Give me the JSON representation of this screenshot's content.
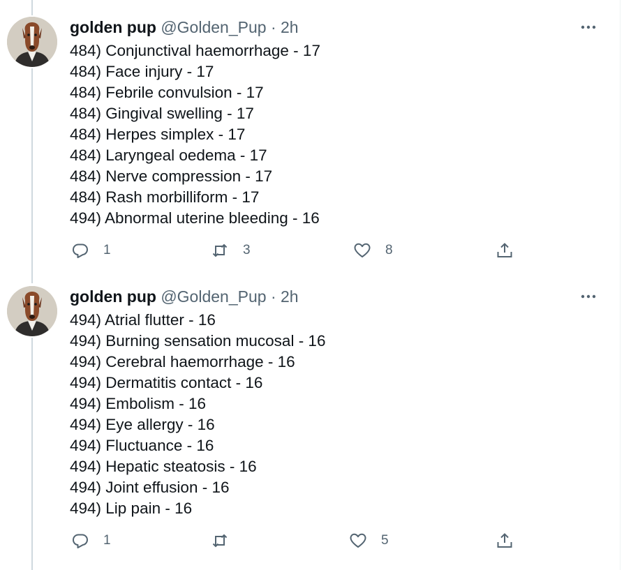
{
  "tweets": [
    {
      "name": "golden pup",
      "handle": "@Golden_Pup",
      "separator": "·",
      "time": "2h",
      "lines": [
        "484) Conjunctival haemorrhage - 17",
        "484) Face injury - 17",
        "484) Febrile convulsion - 17",
        "484) Gingival swelling - 17",
        "484) Herpes simplex - 17",
        "484) Laryngeal oedema - 17",
        "484) Nerve compression - 17",
        "484) Rash morbilliform - 17",
        "494) Abnormal uterine bleeding - 16"
      ],
      "replies": "1",
      "retweets": "3",
      "likes": "8"
    },
    {
      "name": "golden pup",
      "handle": "@Golden_Pup",
      "separator": "·",
      "time": "2h",
      "lines": [
        "494) Atrial flutter - 16",
        "494) Burning sensation mucosal - 16",
        "494) Cerebral haemorrhage - 16",
        "494) Dermatitis contact - 16",
        "494) Embolism - 16",
        "494) Eye allergy - 16",
        "494) Fluctuance - 16",
        "494) Hepatic steatosis - 16",
        "494) Joint effusion - 16",
        "494) Lip pain - 16"
      ],
      "replies": "1",
      "retweets": "",
      "likes": "5"
    }
  ],
  "icons": {
    "more": "more-horizontal-icon",
    "reply": "reply-icon",
    "retweet": "retweet-icon",
    "like": "heart-icon",
    "share": "share-icon"
  },
  "colors": {
    "text": "#0f1419",
    "secondary": "#536471",
    "thread_line": "#cfd9de",
    "divider": "#eff3f4"
  }
}
